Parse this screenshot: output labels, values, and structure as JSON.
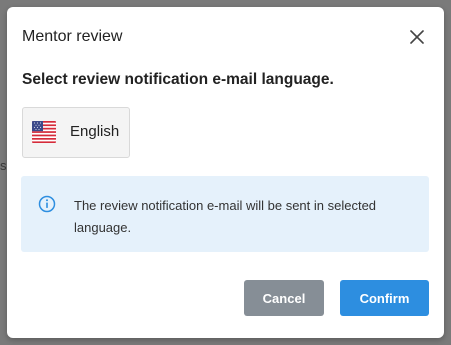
{
  "colors": {
    "primary": "#2d8ee0",
    "secondary": "#868e96",
    "info_background": "#e5f1fb",
    "info_icon": "#2d8ee0"
  },
  "background": {
    "partial_glyph": "s"
  },
  "modal": {
    "title": "Mentor review",
    "close_icon": "close-icon",
    "subtitle": "Select review notification e-mail language.",
    "language_option": {
      "flag_icon": "us-flag-icon",
      "label": "English"
    },
    "info": {
      "icon": "info-circle-icon",
      "text": "The review notification e-mail will be sent in selected language."
    },
    "buttons": {
      "cancel_label": "Cancel",
      "confirm_label": "Confirm"
    }
  }
}
